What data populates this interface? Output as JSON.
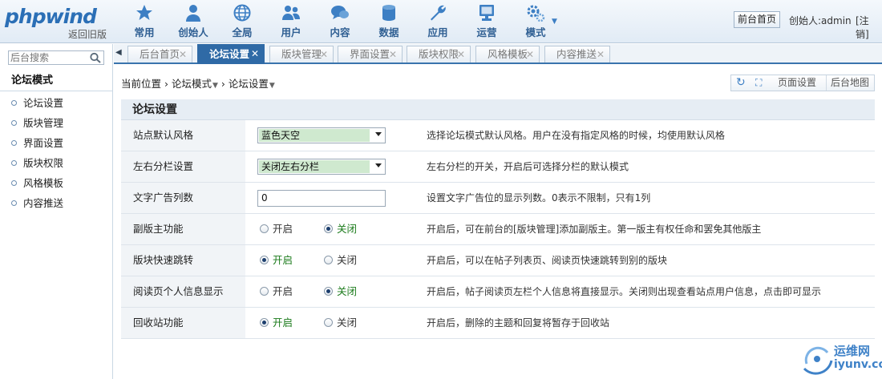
{
  "header": {
    "logo_text": "phpwind",
    "logo_sub": "返回旧版",
    "nav": [
      {
        "label": "常用",
        "icon": "star-icon"
      },
      {
        "label": "创始人",
        "icon": "person-icon"
      },
      {
        "label": "全局",
        "icon": "globe-icon"
      },
      {
        "label": "用户",
        "icon": "users-icon"
      },
      {
        "label": "内容",
        "icon": "chat-bubbles-icon"
      },
      {
        "label": "数据",
        "icon": "database-icon"
      },
      {
        "label": "应用",
        "icon": "wrench-icon"
      },
      {
        "label": "运营",
        "icon": "monitor-icon"
      },
      {
        "label": "模式",
        "icon": "gears-icon"
      }
    ],
    "front_link": "前台首页",
    "creator_text": "创始人:admin",
    "logout_text": "[注销]"
  },
  "sidebar": {
    "search_placeholder": "后台搜索",
    "title": "论坛模式",
    "items": [
      "论坛设置",
      "版块管理",
      "界面设置",
      "版块权限",
      "风格模板",
      "内容推送"
    ]
  },
  "tabs": [
    {
      "label": "后台首页",
      "active": false
    },
    {
      "label": "论坛设置",
      "active": true
    },
    {
      "label": "版块管理",
      "active": false
    },
    {
      "label": "界面设置",
      "active": false
    },
    {
      "label": "版块权限",
      "active": false
    },
    {
      "label": "风格模板",
      "active": false
    },
    {
      "label": "内容推送",
      "active": false
    }
  ],
  "breadcrumb": {
    "prefix": "当前位置",
    "level1": "论坛模式",
    "level2": "论坛设置"
  },
  "tools": {
    "page_settings": "页面设置",
    "admin_map": "后台地图"
  },
  "panel": {
    "title": "论坛设置",
    "rows": [
      {
        "label": "站点默认风格",
        "type": "select",
        "value": "蓝色天空",
        "tip": "选择论坛模式默认风格。用户在没有指定风格的时候，均使用默认风格"
      },
      {
        "label": "左右分栏设置",
        "type": "select",
        "value": "关闭左右分栏",
        "tip": "左右分栏的开关，开启后可选择分栏的默认模式"
      },
      {
        "label": "文字广告列数",
        "type": "text",
        "value": "0",
        "tip": "设置文字广告位的显示列数。0表示不限制，只有1列"
      },
      {
        "label": "副版主功能",
        "type": "radio",
        "options": [
          "开启",
          "关闭"
        ],
        "selected": 1,
        "tip": "开启后，可在前台的[版块管理]添加副版主。第一版主有权任命和罢免其他版主"
      },
      {
        "label": "版块快速跳转",
        "type": "radio",
        "options": [
          "开启",
          "关闭"
        ],
        "selected": 0,
        "tip": "开启后，可以在帖子列表页、阅读页快速跳转到别的版块"
      },
      {
        "label": "阅读页个人信息显示",
        "type": "radio",
        "options": [
          "开启",
          "关闭"
        ],
        "selected": 1,
        "tip": "开启后，帖子阅读页左栏个人信息将直接显示。关闭则出现查看站点用户信息，点击即可显示"
      },
      {
        "label": "回收站功能",
        "type": "radio",
        "options": [
          "开启",
          "关闭"
        ],
        "selected": 0,
        "tip": "开启后，删除的主题和回复将暂存于回收站"
      }
    ]
  },
  "watermark": {
    "cn": "运维网",
    "en": "iyunv.com"
  },
  "colors": {
    "accent": "#2f6aa6",
    "select_highlight": "#cfe9cf",
    "radio_on_text": "#1a7a1a"
  }
}
